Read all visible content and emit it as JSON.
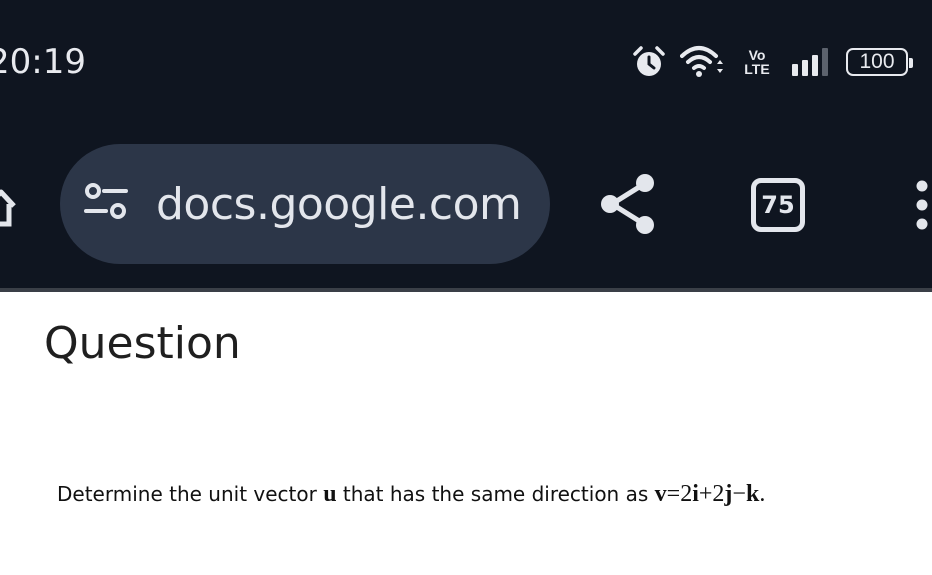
{
  "status_bar": {
    "time": "20:19",
    "volte_top": "Vo",
    "volte_bottom": "LTE",
    "battery": "100",
    "icons": [
      "alarm-icon",
      "wifi-icon",
      "volte-icon",
      "signal-icon",
      "battery-icon"
    ]
  },
  "toolbar": {
    "url": "docs.google.com",
    "tab_count": "75",
    "icons": [
      "home-icon",
      "site-settings-icon",
      "share-icon",
      "tab-switcher-icon",
      "more-vert-icon"
    ]
  },
  "page": {
    "title": "Question",
    "question": {
      "prefix": "Determine the unit vector",
      "vector_u": "u",
      "middle": "that has the same direction as",
      "v": "v",
      "equals": "=",
      "coef_i": "2",
      "i": "i",
      "plus": "+",
      "coef_j": "2",
      "j": "j",
      "minus": "−",
      "k": "k",
      "end": "."
    }
  },
  "colors": {
    "toolbar_bg": "#0f1520",
    "pill_bg": "#2c3648",
    "icon_fg": "#e3e6ec",
    "page_bg": "#ffffff",
    "text": "#111111"
  }
}
